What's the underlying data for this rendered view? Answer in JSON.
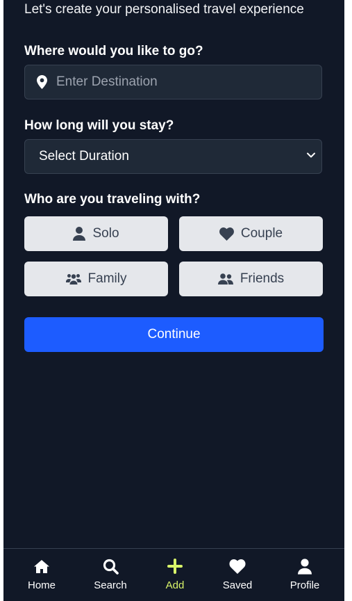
{
  "intro": {
    "subtitle": "Let's create your personalised travel experience"
  },
  "destination": {
    "label": "Where would you like to go?",
    "placeholder": "Enter Destination",
    "value": "",
    "icon": "map-pin-icon"
  },
  "duration": {
    "label": "How long will you stay?",
    "selected": "Select Duration",
    "icon": "chevron-down-icon"
  },
  "companions": {
    "label": "Who are you traveling with?",
    "options": [
      {
        "label": "Solo",
        "icon": "user-icon"
      },
      {
        "label": "Couple",
        "icon": "heart-icon"
      },
      {
        "label": "Family",
        "icon": "users-icon"
      },
      {
        "label": "Friends",
        "icon": "user-friends-icon"
      }
    ]
  },
  "continue_label": "Continue",
  "nav": {
    "items": [
      {
        "label": "Home",
        "icon": "home-icon"
      },
      {
        "label": "Search",
        "icon": "search-icon"
      },
      {
        "label": "Add",
        "icon": "plus-icon",
        "active": true
      },
      {
        "label": "Saved",
        "icon": "heart-icon"
      },
      {
        "label": "Profile",
        "icon": "user-icon"
      }
    ]
  },
  "colors": {
    "background": "#111827",
    "input_bg": "#1f2937",
    "option_bg": "#e5e7eb",
    "primary": "#1d5cff",
    "active_nav": "#d9f46a"
  }
}
